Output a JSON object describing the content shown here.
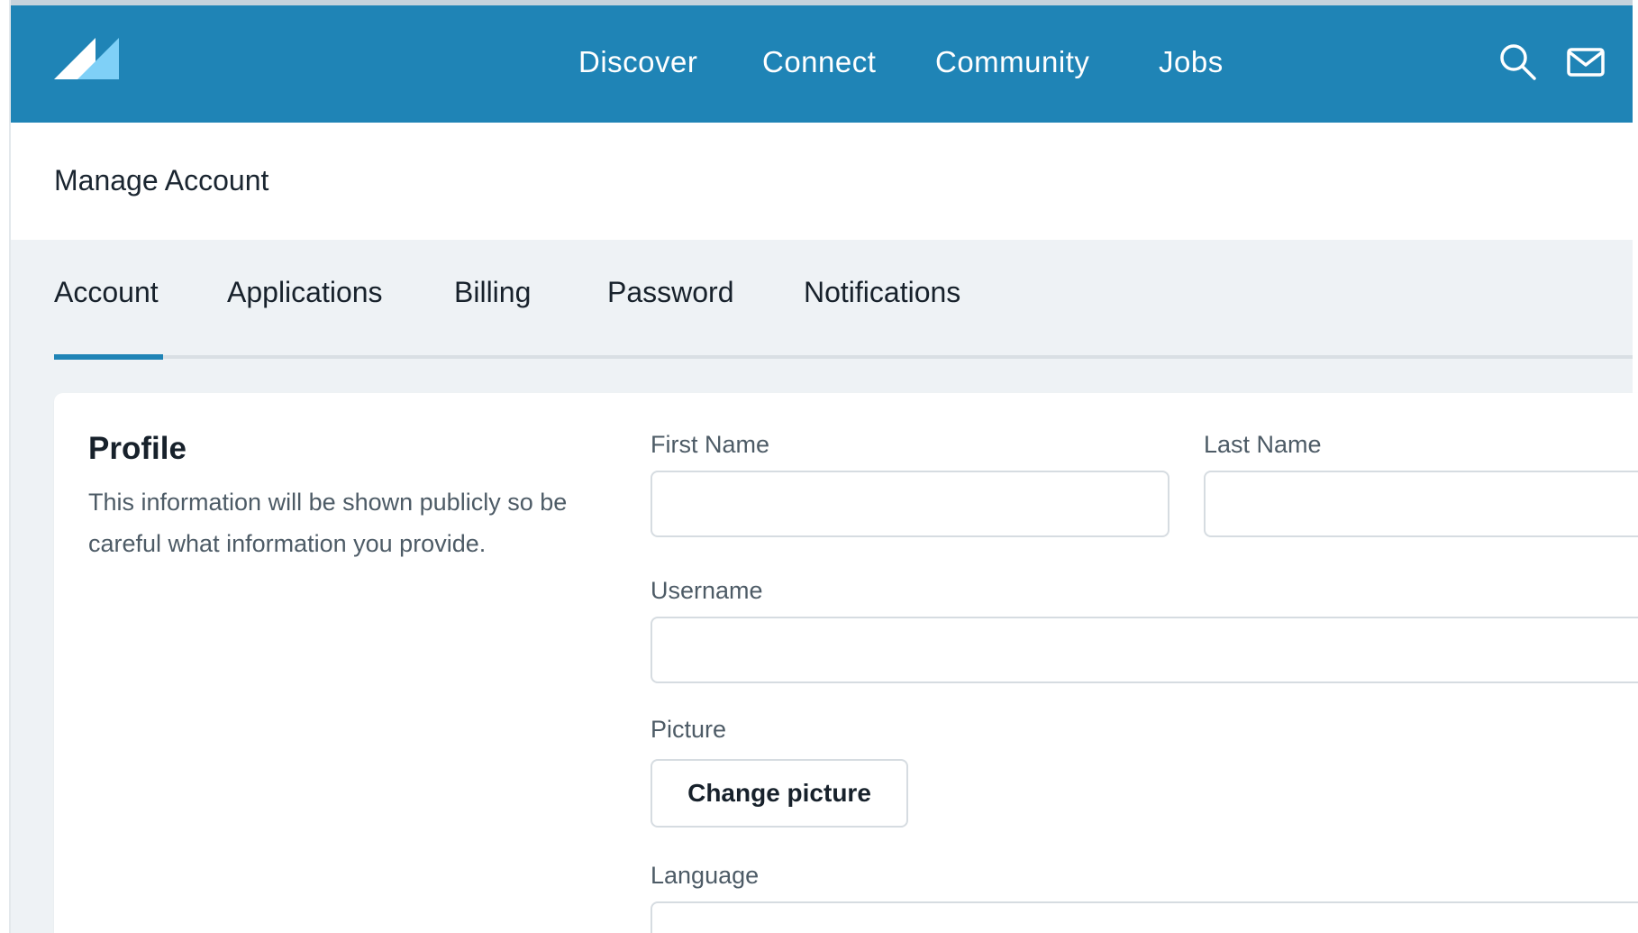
{
  "header": {
    "nav": [
      "Discover",
      "Connect",
      "Community",
      "Jobs"
    ],
    "icons": [
      "search-icon",
      "mail-icon"
    ],
    "brand_color": "#1f84b6"
  },
  "page": {
    "title": "Manage Account"
  },
  "tabs": {
    "items": [
      "Account",
      "Applications",
      "Billing",
      "Password",
      "Notifications"
    ],
    "active": "Account"
  },
  "profile": {
    "title": "Profile",
    "description": "This information will be shown publicly so be careful what information you provide.",
    "first_name_label": "First Name",
    "first_name_value": "",
    "last_name_label": "Last Name",
    "last_name_value": "",
    "username_label": "Username",
    "username_value": "",
    "picture_label": "Picture",
    "change_picture_label": "Change picture",
    "language_label": "Language"
  }
}
